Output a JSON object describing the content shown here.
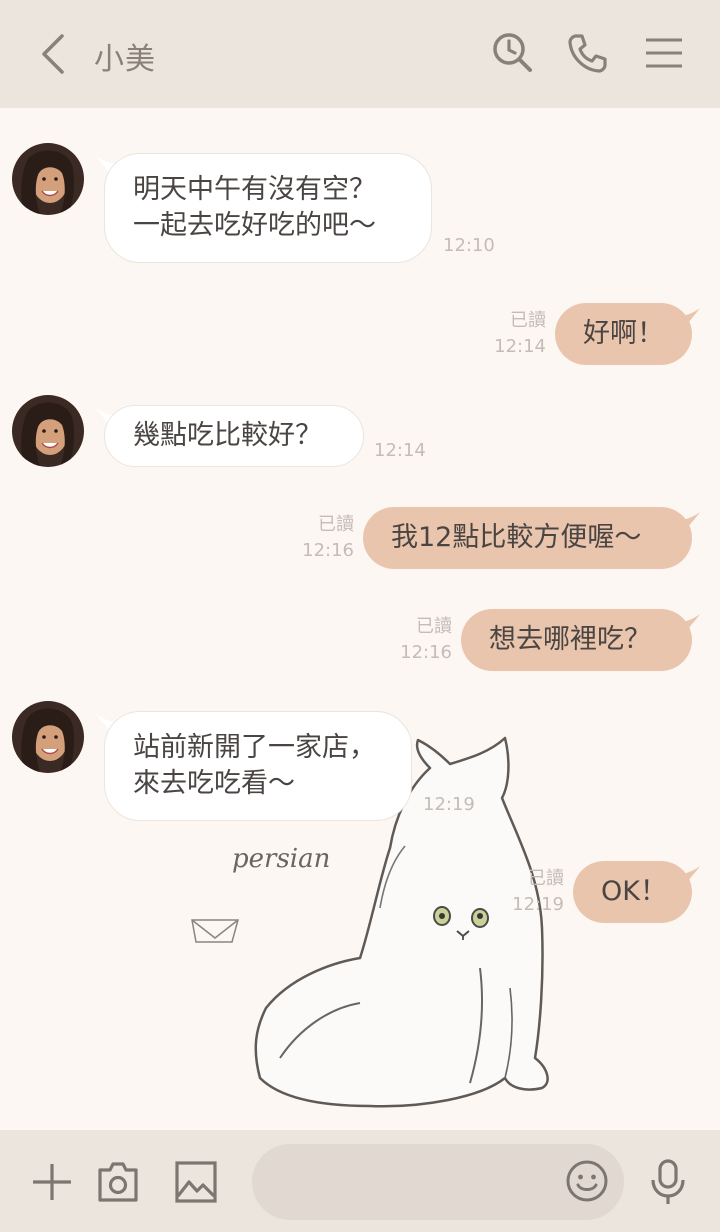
{
  "header": {
    "title": "小美",
    "icons": [
      "back-icon",
      "history-search-icon",
      "phone-icon",
      "menu-icon"
    ]
  },
  "messages": [
    {
      "side": "in",
      "lines": [
        "明天中午有沒有空？",
        "一起去吃好吃的吧～"
      ],
      "time": "12:10"
    },
    {
      "side": "out",
      "text": "好啊！",
      "read": "已讀",
      "time": "12:14"
    },
    {
      "side": "in",
      "lines": [
        "幾點吃比較好？"
      ],
      "time": "12:14"
    },
    {
      "side": "out",
      "text": "我12點比較方便喔～",
      "read": "已讀",
      "time": "12:16"
    },
    {
      "side": "out",
      "text": "想去哪裡吃？",
      "read": "已讀",
      "time": "12:16"
    },
    {
      "side": "in",
      "lines": [
        "站前新開了一家店，",
        "來去吃吃看～"
      ],
      "time": "12:19"
    },
    {
      "side": "out",
      "text": "OK！",
      "read": "已讀",
      "time": "12:19"
    }
  ],
  "background": {
    "caption": "persian"
  },
  "footer": {
    "input_value": "",
    "icons": [
      "plus-icon",
      "camera-icon",
      "image-icon",
      "emoji-icon",
      "mic-icon"
    ]
  },
  "colors": {
    "header_bg": "#ece5de",
    "chat_bg": "#fdf7f3",
    "outgoing_bubble": "#eac5ad",
    "incoming_bubble": "#ffffff",
    "meta_text": "#c4bcb6"
  }
}
